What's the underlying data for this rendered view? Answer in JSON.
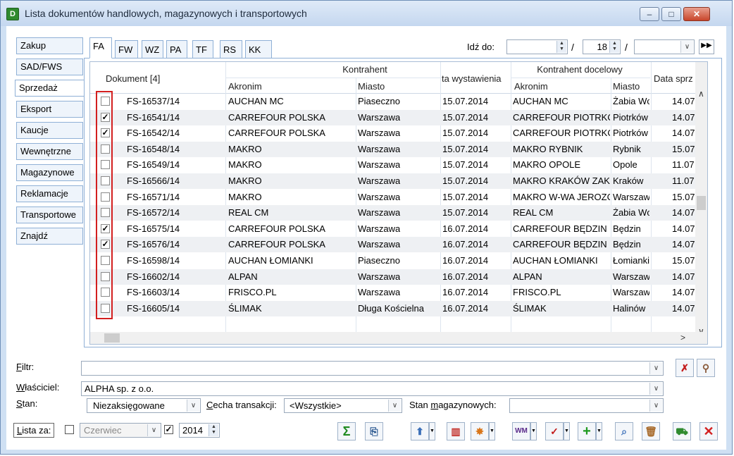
{
  "window": {
    "title": "Lista dokumentów handlowych, magazynowych i transportowych",
    "app_icon": "D",
    "controls": [
      "minimize-icon",
      "maximize-icon",
      "close-icon"
    ]
  },
  "sidebar": {
    "items": [
      {
        "label": "Zakup",
        "active": false
      },
      {
        "label": "SAD/FWS",
        "active": false
      },
      {
        "label": "Sprzedaż",
        "active": true
      },
      {
        "label": "Eksport",
        "active": false
      },
      {
        "label": "Kaucje",
        "active": false
      },
      {
        "label": "Wewnętrzne",
        "active": false
      },
      {
        "label": "Magazynowe",
        "active": false
      },
      {
        "label": "Reklamacje",
        "active": false
      },
      {
        "label": "Transportowe",
        "active": false
      },
      {
        "label": "Znajdź",
        "active": false
      }
    ]
  },
  "doc_tabs": [
    "FA",
    "FW",
    "WZ",
    "PA",
    "TF",
    "RS",
    "KK"
  ],
  "goto": {
    "label": "Idź do:",
    "field1": "",
    "number": "18",
    "field3": ""
  },
  "grid": {
    "headers": {
      "document": "Dokument [4]",
      "contractor_group": "Kontrahent",
      "akronim": "Akronim",
      "miasto": "Miasto",
      "issue_date": "ta wystawienia",
      "target_group": "Kontrahent docelowy",
      "target_akronim": "Akronim",
      "target_miasto": "Miasto",
      "sale_date": "Data sprz"
    },
    "rows": [
      {
        "checked": false,
        "doc": "FS-16537/14",
        "akronim": "AUCHAN MC",
        "miasto": "Piaseczno",
        "date": "15.07.2014",
        "t_akronim": "AUCHAN MC",
        "t_miasto": "Żabia Wc",
        "sale": "14.07"
      },
      {
        "checked": true,
        "doc": "FS-16541/14",
        "akronim": "CARREFOUR POLSKA",
        "miasto": "Warszawa",
        "date": "15.07.2014",
        "t_akronim": "CARREFOUR PIOTRKÓ",
        "t_miasto": "Piotrków",
        "sale": "14.07"
      },
      {
        "checked": true,
        "doc": "FS-16542/14",
        "akronim": "CARREFOUR POLSKA",
        "miasto": "Warszawa",
        "date": "15.07.2014",
        "t_akronim": "CARREFOUR PIOTRKÓ",
        "t_miasto": "Piotrków",
        "sale": "14.07"
      },
      {
        "checked": false,
        "doc": "FS-16548/14",
        "akronim": "MAKRO",
        "miasto": "Warszawa",
        "date": "15.07.2014",
        "t_akronim": "MAKRO RYBNIK",
        "t_miasto": "Rybnik",
        "sale": "15.07"
      },
      {
        "checked": false,
        "doc": "FS-16549/14",
        "akronim": "MAKRO",
        "miasto": "Warszawa",
        "date": "15.07.2014",
        "t_akronim": "MAKRO OPOLE",
        "t_miasto": "Opole",
        "sale": "11.07"
      },
      {
        "checked": false,
        "doc": "FS-16566/14",
        "akronim": "MAKRO",
        "miasto": "Warszawa",
        "date": "15.07.2014",
        "t_akronim": "MAKRO KRAKÓW ZAKC",
        "t_miasto": "Kraków",
        "sale": "11.07"
      },
      {
        "checked": false,
        "doc": "FS-16571/14",
        "akronim": "MAKRO",
        "miasto": "Warszawa",
        "date": "15.07.2014",
        "t_akronim": "MAKRO W-WA JEROZC",
        "t_miasto": "Warszaw",
        "sale": "15.07"
      },
      {
        "checked": false,
        "doc": "FS-16572/14",
        "akronim": "REAL CM",
        "miasto": "Warszawa",
        "date": "15.07.2014",
        "t_akronim": "REAL CM",
        "t_miasto": "Żabia Wc",
        "sale": "14.07"
      },
      {
        "checked": true,
        "doc": "FS-16575/14",
        "akronim": "CARREFOUR POLSKA",
        "miasto": "Warszawa",
        "date": "16.07.2014",
        "t_akronim": "CARREFOUR BĘDZIN",
        "t_miasto": "Będzin",
        "sale": "14.07"
      },
      {
        "checked": true,
        "doc": "FS-16576/14",
        "akronim": "CARREFOUR POLSKA",
        "miasto": "Warszawa",
        "date": "16.07.2014",
        "t_akronim": "CARREFOUR BĘDZIN",
        "t_miasto": "Będzin",
        "sale": "14.07"
      },
      {
        "checked": false,
        "doc": "FS-16598/14",
        "akronim": "AUCHAN ŁOMIANKI",
        "miasto": "Piaseczno",
        "date": "16.07.2014",
        "t_akronim": "AUCHAN ŁOMIANKI",
        "t_miasto": "Łomianki",
        "sale": "15.07"
      },
      {
        "checked": false,
        "doc": "FS-16602/14",
        "akronim": "ALPAN",
        "miasto": "Warszawa",
        "date": "16.07.2014",
        "t_akronim": "ALPAN",
        "t_miasto": "Warszaw",
        "sale": "14.07"
      },
      {
        "checked": false,
        "doc": "FS-16603/14",
        "akronim": "FRISCO.PL",
        "miasto": "Warszawa",
        "date": "16.07.2014",
        "t_akronim": "FRISCO.PL",
        "t_miasto": "Warszaw",
        "sale": "14.07"
      },
      {
        "checked": false,
        "doc": "FS-16605/14",
        "akronim": "ŚLIMAK",
        "miasto": "Długa Kościelna",
        "date": "16.07.2014",
        "t_akronim": "ŚLIMAK",
        "t_miasto": "Halinów",
        "sale": "14.07"
      }
    ]
  },
  "filters": {
    "filter_label": "Filtr:",
    "filter_value": "",
    "owner_label": "Właściciel:",
    "owner_value": "ALPHA  sp. z o.o.",
    "state_label": "Stan:",
    "state_value": "Niezaksięgowane",
    "trans_label": "Cecha transakcji:",
    "trans_value": "<Wszystkie>",
    "stock_label": "Stan magazynowych:",
    "stock_value": ""
  },
  "period": {
    "label": "Lista za:",
    "month": "Czerwiec",
    "month_checked": false,
    "year_checked": true,
    "year": "2014"
  },
  "colors": {
    "accent": "#d31f1f",
    "frame": "#cfe0f3"
  }
}
